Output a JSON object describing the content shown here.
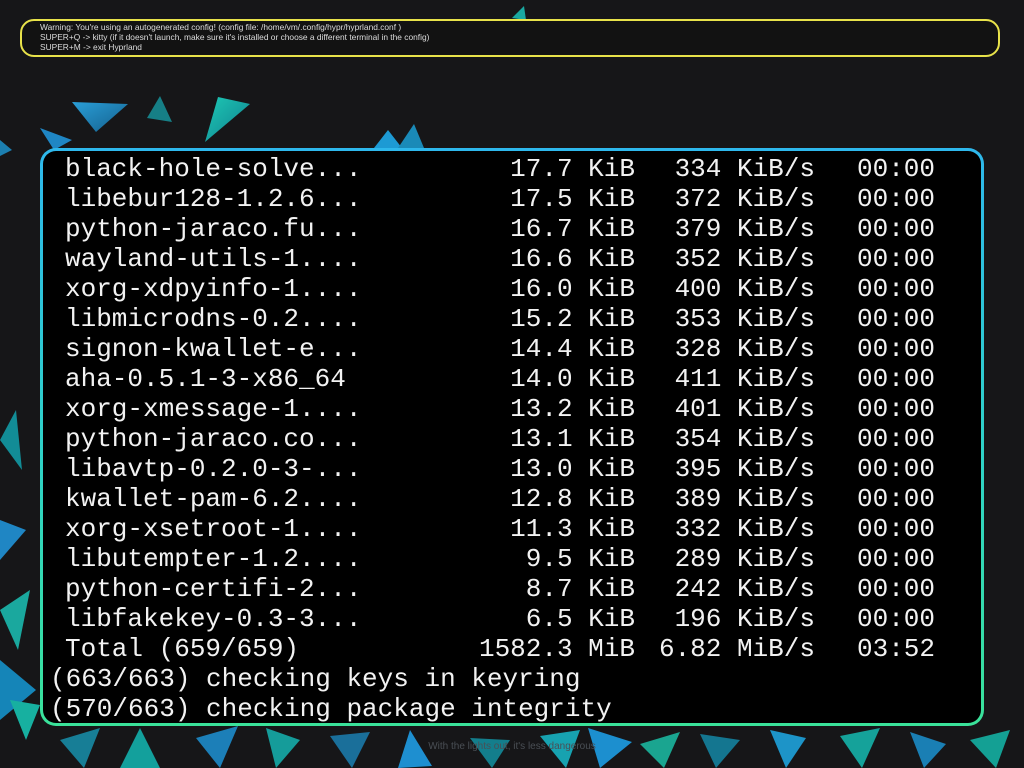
{
  "notice": {
    "lines": [
      "Warning: You're using an autogenerated config! (config file: /home/vm/.config/hypr/hyprland.conf )",
      "SUPER+Q -> kitty (if it doesn't launch, make sure it's installed or choose a different terminal in the config)",
      "SUPER+M -> exit Hyprland"
    ]
  },
  "terminal": {
    "downloads": [
      {
        "name": "black-hole-solve...",
        "size": "17.7 KiB",
        "speed": "334 KiB/s",
        "eta": "00:00"
      },
      {
        "name": "libebur128-1.2.6...",
        "size": "17.5 KiB",
        "speed": "372 KiB/s",
        "eta": "00:00"
      },
      {
        "name": "python-jaraco.fu...",
        "size": "16.7 KiB",
        "speed": "379 KiB/s",
        "eta": "00:00"
      },
      {
        "name": "wayland-utils-1....",
        "size": "16.6 KiB",
        "speed": "352 KiB/s",
        "eta": "00:00"
      },
      {
        "name": "xorg-xdpyinfo-1....",
        "size": "16.0 KiB",
        "speed": "400 KiB/s",
        "eta": "00:00"
      },
      {
        "name": "libmicrodns-0.2....",
        "size": "15.2 KiB",
        "speed": "353 KiB/s",
        "eta": "00:00"
      },
      {
        "name": "signon-kwallet-e...",
        "size": "14.4 KiB",
        "speed": "328 KiB/s",
        "eta": "00:00"
      },
      {
        "name": "aha-0.5.1-3-x86_64",
        "size": "14.0 KiB",
        "speed": "411 KiB/s",
        "eta": "00:00"
      },
      {
        "name": "xorg-xmessage-1....",
        "size": "13.2 KiB",
        "speed": "401 KiB/s",
        "eta": "00:00"
      },
      {
        "name": "python-jaraco.co...",
        "size": "13.1 KiB",
        "speed": "354 KiB/s",
        "eta": "00:00"
      },
      {
        "name": "libavtp-0.2.0-3-...",
        "size": "13.0 KiB",
        "speed": "395 KiB/s",
        "eta": "00:00"
      },
      {
        "name": "kwallet-pam-6.2....",
        "size": "12.8 KiB",
        "speed": "389 KiB/s",
        "eta": "00:00"
      },
      {
        "name": "xorg-xsetroot-1....",
        "size": "11.3 KiB",
        "speed": "332 KiB/s",
        "eta": "00:00"
      },
      {
        "name": "libutempter-1.2....",
        "size": "9.5 KiB",
        "speed": "289 KiB/s",
        "eta": "00:00"
      },
      {
        "name": "python-certifi-2...",
        "size": "8.7 KiB",
        "speed": "242 KiB/s",
        "eta": "00:00"
      },
      {
        "name": "libfakekey-0.3-3...",
        "size": "6.5 KiB",
        "speed": "196 KiB/s",
        "eta": "00:00"
      }
    ],
    "total": {
      "name": "Total (659/659)",
      "size": "1582.3 MiB",
      "speed": "6.82 MiB/s",
      "eta": "03:52"
    },
    "status_lines": [
      "(663/663) checking keys in keyring",
      "(570/663) checking package integrity"
    ]
  },
  "tagline": "With the lights out, it's less dangerous",
  "colors": {
    "notice_border": "#e8e24a",
    "terminal_border_top": "#2eb8ec",
    "terminal_border_bottom": "#3ae29a",
    "terminal_bg": "#000000",
    "terminal_text": "#f2f2f2"
  }
}
